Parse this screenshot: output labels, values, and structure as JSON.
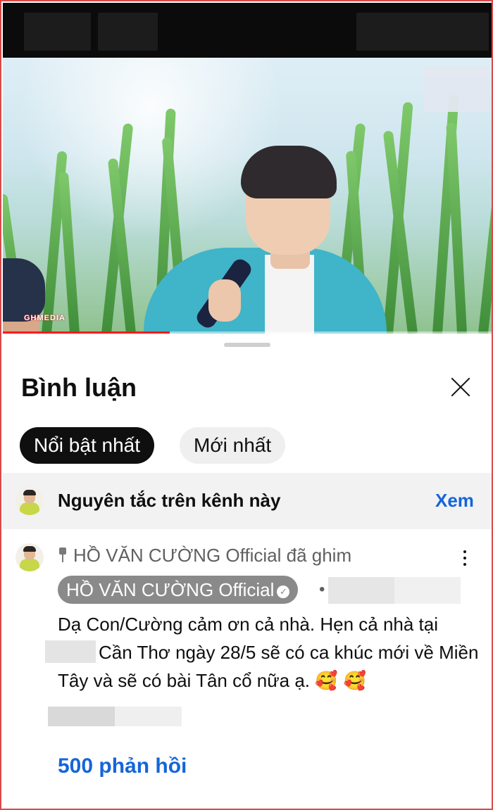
{
  "comments_panel": {
    "title": "Bình luận",
    "filters": [
      {
        "label": "Nổi bật nhất",
        "active": true
      },
      {
        "label": "Mới nhất",
        "active": false
      }
    ],
    "guidelines": {
      "text": "Nguyên tắc trên kênh này",
      "link_label": "Xem"
    },
    "pinned_comment": {
      "pinned_by_text": "HỒ VĂN CƯỜNG Official đã ghim",
      "author": "HỒ VĂN CƯỜNG Official",
      "separator": "•",
      "text_part1": "Dạ Con/Cường cảm ơn cả nhà. Hẹn cả nhà tại",
      "text_part2": "Cần Thơ ngày 28/5 sẽ có ca khúc mới về Miền Tây và sẽ có bài Tân cổ nữa ạ.",
      "emojis": "🥰 🥰",
      "replies_label": "500 phản hồi"
    }
  },
  "video": {
    "brand_text": "GHMEDIA",
    "progress_fraction": 0.34
  },
  "colors": {
    "accent_link": "#1565d8",
    "progress": "#ff1a1a",
    "frame_border": "#d84a4a"
  },
  "icons": {
    "close": "close-icon",
    "pin": "pin-icon",
    "verified": "verified-check-icon",
    "more": "more-vert-icon"
  }
}
